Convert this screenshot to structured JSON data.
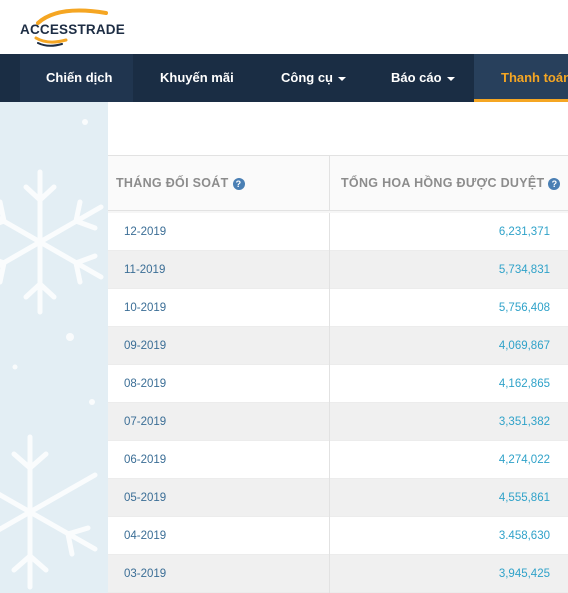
{
  "brand": {
    "logo_text": "ACCESSTRADE",
    "accent_color": "#f5a623",
    "nav_color": "#1a2d44"
  },
  "nav": {
    "items": [
      {
        "label": "Chiến dịch",
        "has_caret": false
      },
      {
        "label": "Khuyến mãi",
        "has_caret": false
      },
      {
        "label": "Công cụ",
        "has_caret": true
      },
      {
        "label": "Báo cáo",
        "has_caret": true
      },
      {
        "label": "Thanh toán",
        "has_caret": false,
        "active": true
      }
    ]
  },
  "table": {
    "headers": {
      "month": "THÁNG ĐỐI SOÁT",
      "commission": "TỔNG HOA HỒNG ĐƯỢC DUYỆT"
    },
    "help_icon": "?",
    "rows": [
      {
        "month": "12-2019",
        "amount": "6,231,371"
      },
      {
        "month": "11-2019",
        "amount": "5,734,831"
      },
      {
        "month": "10-2019",
        "amount": "5,756,408"
      },
      {
        "month": "09-2019",
        "amount": "4,069,867"
      },
      {
        "month": "08-2019",
        "amount": "4,162,865"
      },
      {
        "month": "07-2019",
        "amount": "3,351,382"
      },
      {
        "month": "06-2019",
        "amount": "4,274,022"
      },
      {
        "month": "05-2019",
        "amount": "4,555,861"
      },
      {
        "month": "04-2019",
        "amount": "3.458,630"
      },
      {
        "month": "03-2019",
        "amount": "3,945,425"
      }
    ]
  }
}
